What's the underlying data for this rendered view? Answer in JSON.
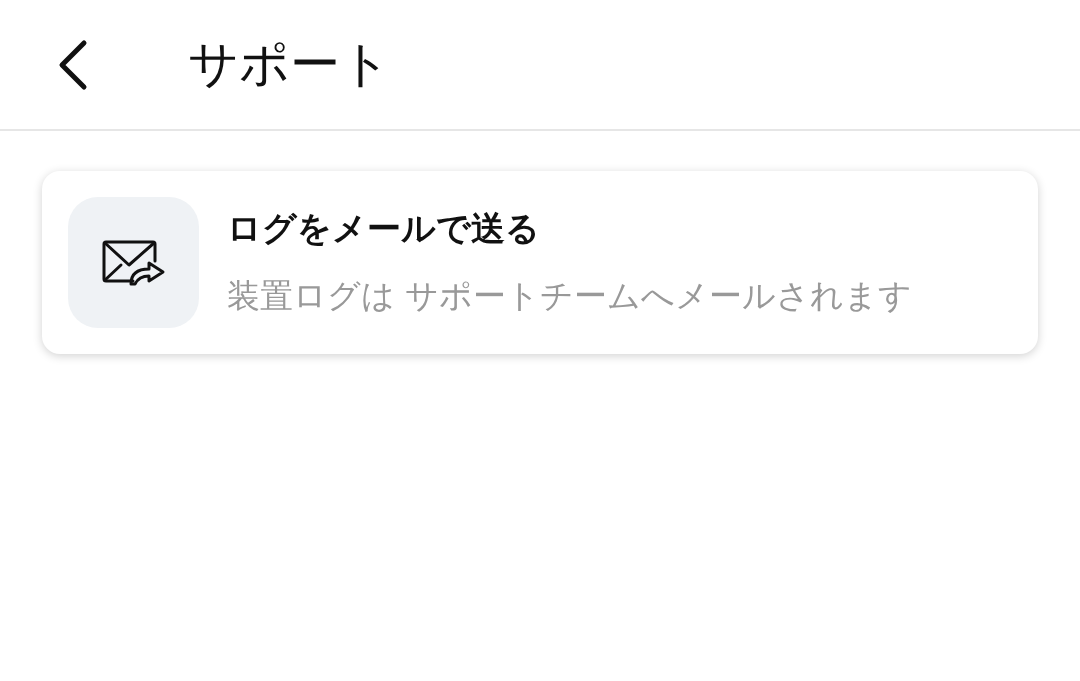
{
  "header": {
    "title": "サポート"
  },
  "items": [
    {
      "title": "ログをメールで送る",
      "description": "装置ログは サポートチームへメールされます"
    }
  ]
}
